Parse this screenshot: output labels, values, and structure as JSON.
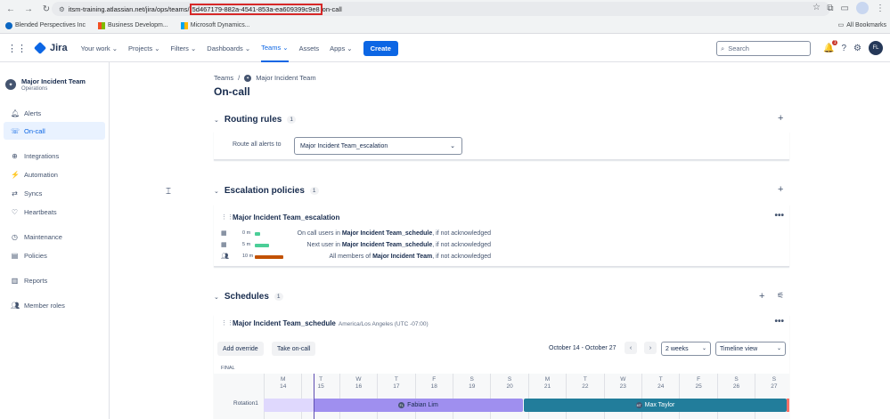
{
  "browser": {
    "url_prefix": "itsm-training.atlassian.net/jira/ops/teams/",
    "url_highlight": "5d467179-882a-4541-853a-ea609399c9e8",
    "url_suffix": "on-call",
    "bookmarks": [
      "Blended Perspectives Inc",
      "Business Developm...",
      "Microsoft Dynamics..."
    ],
    "all_bookmarks": "All Bookmarks"
  },
  "topnav": {
    "product": "Jira",
    "menu": [
      "Your work",
      "Projects",
      "Filters",
      "Dashboards",
      "Teams",
      "Assets",
      "Apps"
    ],
    "create": "Create",
    "search_placeholder": "Search",
    "notif_count": "1",
    "user_initials": "FL"
  },
  "sidebar": {
    "team_name": "Major Incident Team",
    "team_sub": "Operations",
    "items": [
      {
        "label": "Alerts",
        "icon": "bell-icon"
      },
      {
        "label": "On-call",
        "icon": "oncall-icon"
      },
      {
        "label": "Integrations",
        "icon": "integrations-icon"
      },
      {
        "label": "Automation",
        "icon": "automation-icon"
      },
      {
        "label": "Syncs",
        "icon": "sync-icon"
      },
      {
        "label": "Heartbeats",
        "icon": "heart-icon"
      },
      {
        "label": "Maintenance",
        "icon": "maintenance-icon"
      },
      {
        "label": "Policies",
        "icon": "policies-icon"
      },
      {
        "label": "Reports",
        "icon": "reports-icon"
      },
      {
        "label": "Member roles",
        "icon": "members-icon"
      }
    ]
  },
  "main": {
    "breadcrumb_root": "Teams",
    "breadcrumb_team": "Major Incident Team",
    "title": "On-call",
    "routing": {
      "title": "Routing rules",
      "count": "1",
      "route_label": "Route all alerts to",
      "route_value": "Major Incident Team_escalation"
    },
    "escalation": {
      "title": "Escalation policies",
      "count": "1",
      "policy_name": "Major Incident Team_escalation",
      "rules": [
        {
          "time": "0 m",
          "pre": "On call users in ",
          "target": "Major Incident Team_schedule",
          "post": ", if not acknowledged",
          "color": "#4bce97"
        },
        {
          "time": "5 m",
          "pre": "Next user in ",
          "target": "Major Incident Team_schedule",
          "post": ", if not acknowledged",
          "color": "#4bce97"
        },
        {
          "time": "10 m",
          "pre": "All members of ",
          "target": "Major Incident Team",
          "post": ", if not acknowledged",
          "color": "#c25100"
        }
      ]
    },
    "schedules": {
      "title": "Schedules",
      "count": "1",
      "schedule_name": "Major Incident Team_schedule",
      "timezone": "America/Los Angeles (UTC -07:00)",
      "add_override": "Add override",
      "take_oncall": "Take on-call",
      "range": "October 14 - October 27",
      "period": "2 weeks",
      "view": "Timeline view",
      "final_label": "FINAL",
      "rotation_label": "Rotation1",
      "days": [
        {
          "l": "M",
          "n": "14"
        },
        {
          "l": "T",
          "n": "15"
        },
        {
          "l": "W",
          "n": "16"
        },
        {
          "l": "T",
          "n": "17"
        },
        {
          "l": "F",
          "n": "18"
        },
        {
          "l": "S",
          "n": "19"
        },
        {
          "l": "S",
          "n": "20"
        },
        {
          "l": "M",
          "n": "21"
        },
        {
          "l": "T",
          "n": "22"
        },
        {
          "l": "W",
          "n": "23"
        },
        {
          "l": "T",
          "n": "24"
        },
        {
          "l": "F",
          "n": "25"
        },
        {
          "l": "S",
          "n": "26"
        },
        {
          "l": "S",
          "n": "27"
        }
      ],
      "shifts": [
        {
          "name": "Fabian Lim",
          "initials": "FL",
          "color": "#9f8fef"
        },
        {
          "name": "Max Taylor",
          "initials": "MT",
          "color": "#227d9b"
        }
      ]
    }
  },
  "colors": {
    "accent": "#0c66e4",
    "highlight_border": "#d62828"
  }
}
